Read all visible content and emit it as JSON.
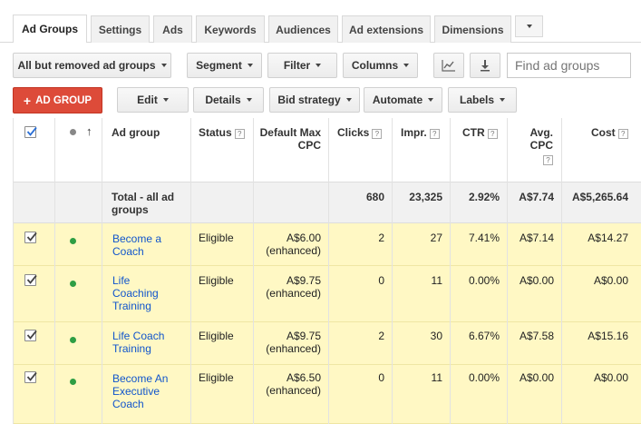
{
  "tabs": [
    {
      "label": "Ad Groups",
      "active": true
    },
    {
      "label": "Settings"
    },
    {
      "label": "Ads"
    },
    {
      "label": "Keywords"
    },
    {
      "label": "Audiences"
    },
    {
      "label": "Ad extensions"
    },
    {
      "label": "Dimensions"
    }
  ],
  "toolbar": {
    "filter_view": "All but removed ad groups",
    "segment": "Segment",
    "filter": "Filter",
    "columns": "Columns",
    "search_placeholder": "Find ad groups"
  },
  "actions": {
    "add": "AD GROUP",
    "edit": "Edit",
    "details": "Details",
    "bid_strategy": "Bid strategy",
    "automate": "Automate",
    "labels": "Labels"
  },
  "table": {
    "headers": {
      "ad_group": "Ad group",
      "status": "Status",
      "default_max_cpc": "Default Max CPC",
      "clicks": "Clicks",
      "impr": "Impr.",
      "ctr": "CTR",
      "avg_cpc": "Avg. CPC",
      "cost": "Cost"
    },
    "total": {
      "label": "Total - all ad groups",
      "clicks": "680",
      "impr": "23,325",
      "ctr": "2.92%",
      "avg_cpc": "A$7.74",
      "cost": "A$5,265.64"
    },
    "rows": [
      {
        "name": "Become a Coach",
        "status": "Eligible",
        "cpc": "A$6.00",
        "cpc_note": "(enhanced)",
        "clicks": "2",
        "impr": "27",
        "ctr": "7.41%",
        "avg_cpc": "A$7.14",
        "cost": "A$14.27"
      },
      {
        "name": "Life Coaching Training",
        "status": "Eligible",
        "cpc": "A$9.75",
        "cpc_note": "(enhanced)",
        "clicks": "0",
        "impr": "11",
        "ctr": "0.00%",
        "avg_cpc": "A$0.00",
        "cost": "A$0.00"
      },
      {
        "name": "Life Coach Training",
        "status": "Eligible",
        "cpc": "A$9.75",
        "cpc_note": "(enhanced)",
        "clicks": "2",
        "impr": "30",
        "ctr": "6.67%",
        "avg_cpc": "A$7.58",
        "cost": "A$15.16"
      },
      {
        "name": "Become An Executive Coach",
        "status": "Eligible",
        "cpc": "A$6.50",
        "cpc_note": "(enhanced)",
        "clicks": "0",
        "impr": "11",
        "ctr": "0.00%",
        "avg_cpc": "A$0.00",
        "cost": "A$0.00"
      }
    ]
  },
  "colors": {
    "accent_red": "#dd4b39",
    "row_highlight": "#fff8c4",
    "status_dot": "#2e9e44",
    "link": "#1155cc"
  }
}
